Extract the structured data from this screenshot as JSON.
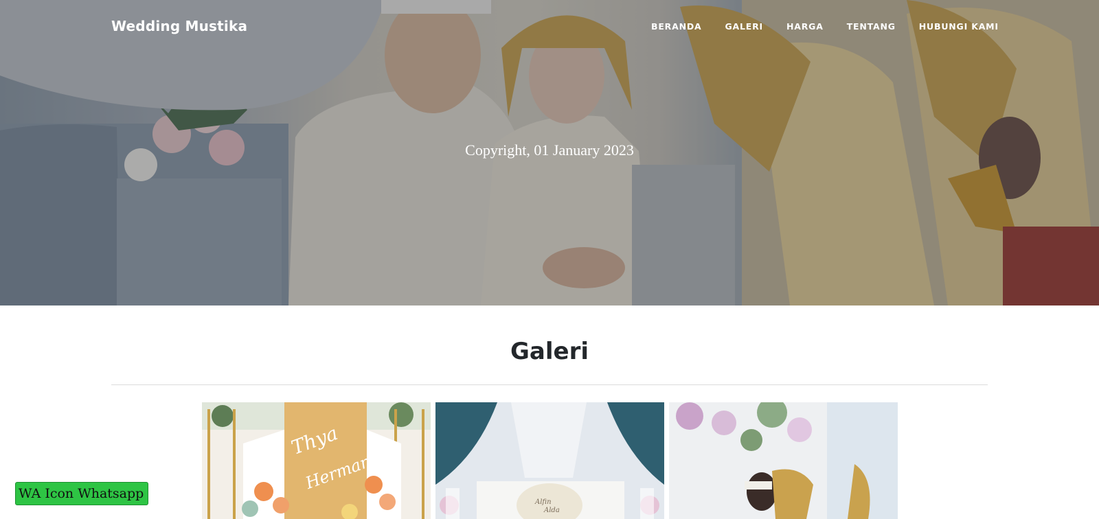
{
  "navbar": {
    "brand": "Wedding Mustika",
    "links": [
      "BERANDA",
      "GALERI",
      "HARGA",
      "TENTANG",
      "HUBUNGI KAMI"
    ]
  },
  "hero": {
    "text": "Copyright, 01 January 2023"
  },
  "gallery": {
    "title": "Galeri",
    "photo1_sign_text": "Thya Herman",
    "photo2_sign_text": "Alfin Alda"
  },
  "whatsapp_button": {
    "label": "WA Icon Whatsapp"
  },
  "colors": {
    "accent_gold": "#c9a24e",
    "whatsapp_green": "#2ec444",
    "title_text": "#23272b"
  }
}
